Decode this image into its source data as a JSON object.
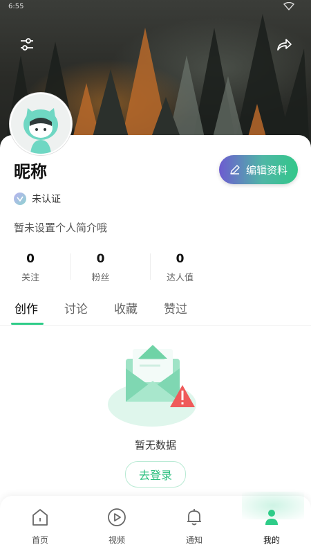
{
  "status": {
    "time": "6:55"
  },
  "profile": {
    "nickname": "昵称",
    "edit_label": "编辑资料",
    "verify_label": "未认证",
    "bio": "暂未设置个人简介哦"
  },
  "stats": [
    {
      "value": "0",
      "label": "关注"
    },
    {
      "value": "0",
      "label": "粉丝"
    },
    {
      "value": "0",
      "label": "达人值"
    }
  ],
  "tabs": [
    {
      "label": "创作"
    },
    {
      "label": "讨论"
    },
    {
      "label": "收藏"
    },
    {
      "label": "赞过"
    }
  ],
  "empty": {
    "message": "暂无数据",
    "login_label": "去登录"
  },
  "nav": [
    {
      "label": "首页",
      "icon": "home-icon"
    },
    {
      "label": "视频",
      "icon": "video-icon"
    },
    {
      "label": "通知",
      "icon": "bell-icon"
    },
    {
      "label": "我的",
      "icon": "user-icon"
    }
  ],
  "colors": {
    "accent": "#2ecc88",
    "edit_gradient_start": "#6d5bd0",
    "edit_gradient_end": "#32c789"
  }
}
